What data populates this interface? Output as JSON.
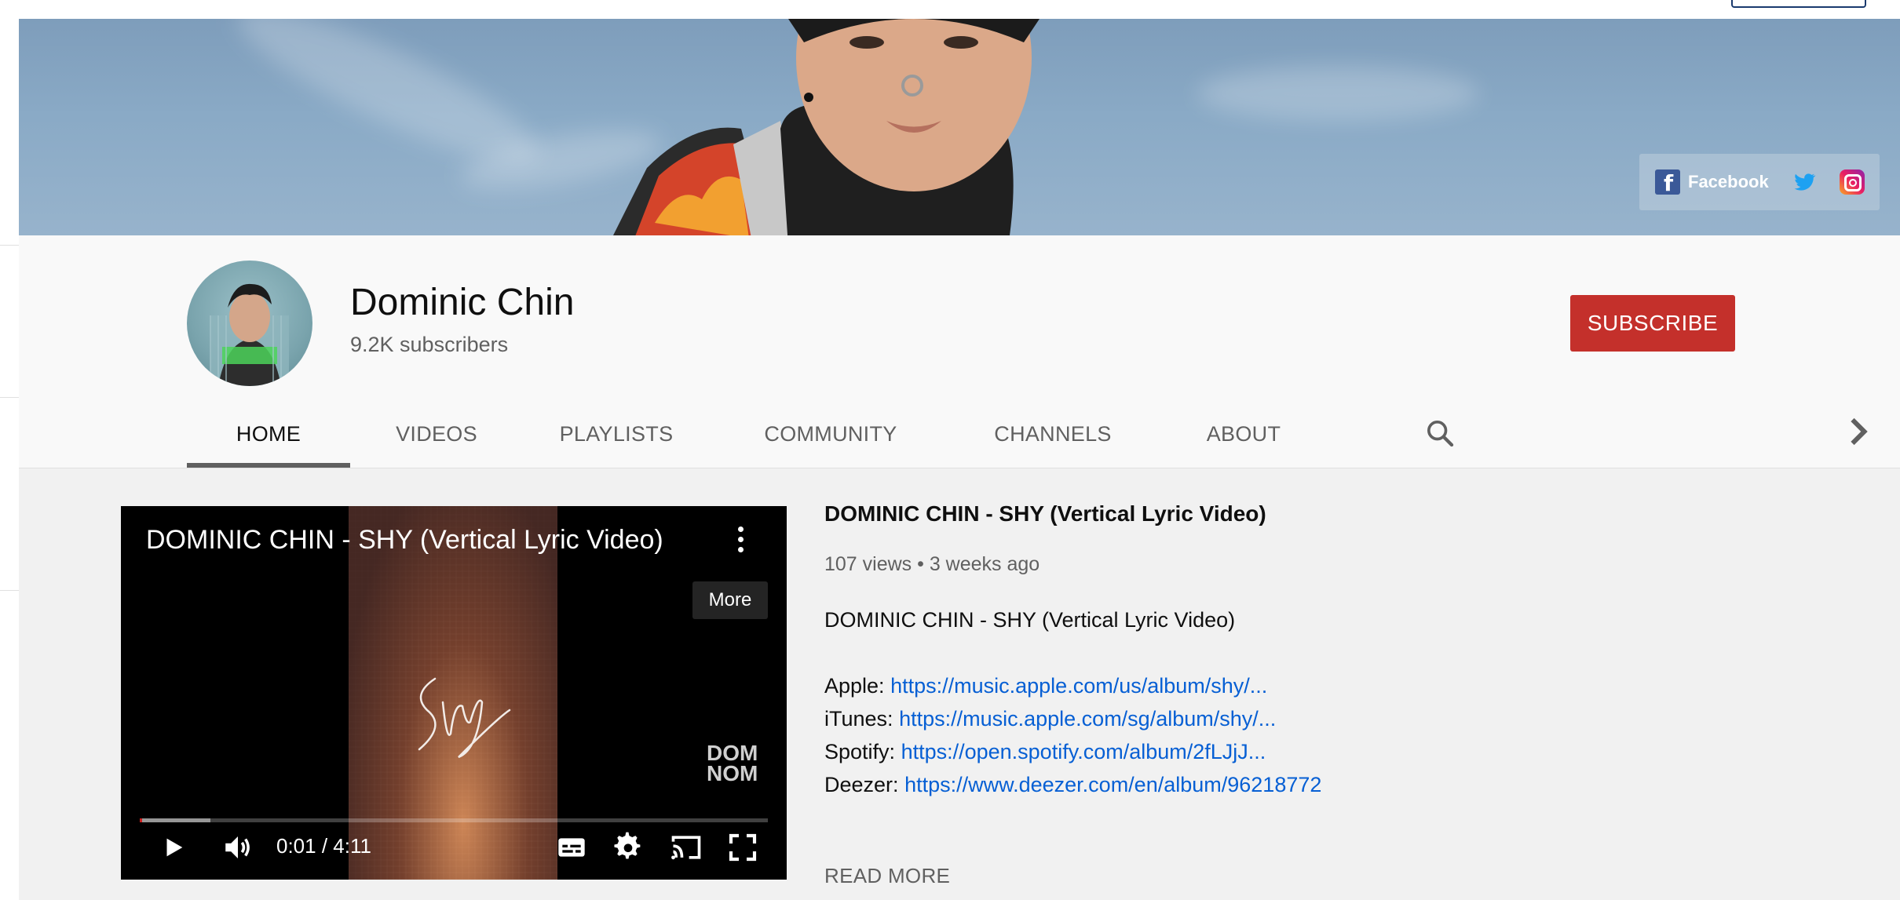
{
  "banner": {
    "social": {
      "facebook_label": "Facebook"
    }
  },
  "channel": {
    "name": "Dominic Chin",
    "subscribers": "9.2K subscribers",
    "subscribe_label": "SUBSCRIBE"
  },
  "tabs": [
    {
      "label": "HOME",
      "active": true
    },
    {
      "label": "VIDEOS",
      "active": false
    },
    {
      "label": "PLAYLISTS",
      "active": false
    },
    {
      "label": "COMMUNITY",
      "active": false
    },
    {
      "label": "CHANNELS",
      "active": false
    },
    {
      "label": "ABOUT",
      "active": false
    }
  ],
  "player": {
    "title": "DOMINIC CHIN - SHY (Vertical Lyric Video)",
    "more_label": "More",
    "watermark_line1": "DOM",
    "watermark_line2": "NOM",
    "time": "0:01 / 4:11",
    "progress": 0.004
  },
  "video_info": {
    "title": "DOMINIC CHIN - SHY (Vertical Lyric Video)",
    "meta": "107 views • 3 weeks ago",
    "description_first": "DOMINIC CHIN - SHY (Vertical Lyric Video)",
    "links": [
      {
        "label": "Apple:",
        "url": "https://music.apple.com/us/album/shy/..."
      },
      {
        "label": "iTunes:",
        "url": "https://music.apple.com/sg/album/shy/..."
      },
      {
        "label": "Spotify:",
        "url": "https://open.spotify.com/album/2fLJjJ..."
      },
      {
        "label": "Deezer:",
        "url": "https://www.deezer.com/en/album/96218772"
      }
    ],
    "read_more": "READ MORE"
  },
  "colors": {
    "subscribe": "#c4302b",
    "link": "#065fd4",
    "progress": "#cc2020"
  },
  "icons": {
    "tab_search": "search-icon",
    "tabs_next": "chevron-right-icon",
    "player": [
      "play-icon",
      "volume-icon",
      "subtitles-icon",
      "gear-icon",
      "cast-icon",
      "fullscreen-icon",
      "more-vert-icon"
    ],
    "social": [
      "facebook-icon",
      "twitter-icon",
      "instagram-icon"
    ]
  }
}
